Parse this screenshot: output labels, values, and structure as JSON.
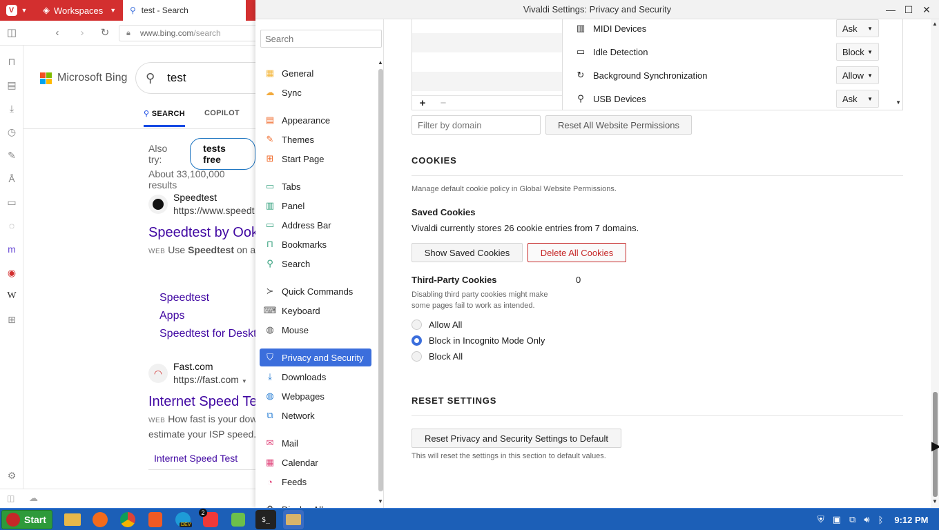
{
  "browser": {
    "workspaces_label": "Workspaces",
    "active_tab_title": "test - Search",
    "url_host": "www.bing.com",
    "url_path": "/search"
  },
  "bing": {
    "logo_text": "Microsoft Bing",
    "query": "test",
    "tabs": [
      "SEARCH",
      "COPILOT"
    ],
    "also_try_label": "Also try:",
    "also_try_chip": "tests free",
    "result_count": "About 33,100,000 results",
    "results": [
      {
        "site": "Speedtest",
        "url": "https://www.speedt",
        "title": "Speedtest by Ookl",
        "snippet_tag": "WEB",
        "snippet_pre": "Use ",
        "snippet_bold": "Speedtest",
        "snippet_post": " on al"
      },
      {
        "site": "Fast.com",
        "url": "https://fast.com",
        "title": "Internet Speed Te",
        "snippet_tag": "WEB",
        "snippet": "How fast is your dow",
        "snippet2": "estimate your ISP speed."
      }
    ],
    "deep_links": [
      "Speedtest",
      "Apps",
      "Speedtest for Deskt"
    ],
    "bottom_pill": "Internet Speed Test"
  },
  "settings": {
    "window_title": "Vivaldi Settings: Privacy and Security",
    "search_placeholder": "Search",
    "nav": [
      {
        "label": "General",
        "icon": "general-icon"
      },
      {
        "label": "Sync",
        "icon": "sync-icon"
      },
      {
        "label": "Appearance",
        "icon": "appearance-icon"
      },
      {
        "label": "Themes",
        "icon": "themes-icon"
      },
      {
        "label": "Start Page",
        "icon": "start-page-icon"
      },
      {
        "label": "Tabs",
        "icon": "tabs-icon"
      },
      {
        "label": "Panel",
        "icon": "panel-icon"
      },
      {
        "label": "Address Bar",
        "icon": "address-bar-icon"
      },
      {
        "label": "Bookmarks",
        "icon": "bookmarks-icon"
      },
      {
        "label": "Search",
        "icon": "search-icon"
      },
      {
        "label": "Quick Commands",
        "icon": "quick-commands-icon"
      },
      {
        "label": "Keyboard",
        "icon": "keyboard-icon"
      },
      {
        "label": "Mouse",
        "icon": "mouse-icon"
      },
      {
        "label": "Privacy and Security",
        "icon": "shield-icon",
        "active": true
      },
      {
        "label": "Downloads",
        "icon": "downloads-icon"
      },
      {
        "label": "Webpages",
        "icon": "globe-icon"
      },
      {
        "label": "Network",
        "icon": "network-icon"
      },
      {
        "label": "Mail",
        "icon": "mail-icon"
      },
      {
        "label": "Calendar",
        "icon": "calendar-icon"
      },
      {
        "label": "Feeds",
        "icon": "feeds-icon"
      },
      {
        "label": "Display All",
        "icon": "gear-icon"
      }
    ],
    "permissions": [
      {
        "name": "MIDI Devices",
        "value": "Ask",
        "icon": "midi-icon"
      },
      {
        "name": "Idle Detection",
        "value": "Block",
        "icon": "laptop-icon"
      },
      {
        "name": "Background Synchronization",
        "value": "Allow",
        "icon": "sync-arrows-icon"
      },
      {
        "name": "USB Devices",
        "value": "Ask",
        "icon": "usb-icon"
      }
    ],
    "filter_placeholder": "Filter by domain",
    "reset_permissions_label": "Reset All Website Permissions",
    "cookies": {
      "title": "COOKIES",
      "hint": "Manage default cookie policy in Global Website Permissions.",
      "saved_title": "Saved Cookies",
      "saved_text": "Vivaldi currently stores 26 cookie entries from 7 domains.",
      "show_btn": "Show Saved Cookies",
      "delete_btn": "Delete All Cookies",
      "third_party_title": "Third-Party Cookies",
      "third_party_count": "0",
      "third_party_hint_1": "Disabling third party cookies might make",
      "third_party_hint_2": "some pages fail to work as intended.",
      "options": [
        "Allow All",
        "Block in Incognito Mode Only",
        "Block All"
      ],
      "selected_option": "Block in Incognito Mode Only"
    },
    "reset": {
      "title": "RESET SETTINGS",
      "button": "Reset Privacy and Security Settings to Default",
      "hint": "This will reset the settings in this section to default values."
    }
  },
  "taskbar": {
    "start_label": "Start",
    "badge_count": "2",
    "dev_badge": "DEV",
    "clock": "9:12 PM"
  },
  "colors": {
    "accent": "#3b6edc",
    "vivaldi_red": "#d32f2f",
    "taskbar": "#1c5fb7",
    "link": "#4007a2"
  }
}
